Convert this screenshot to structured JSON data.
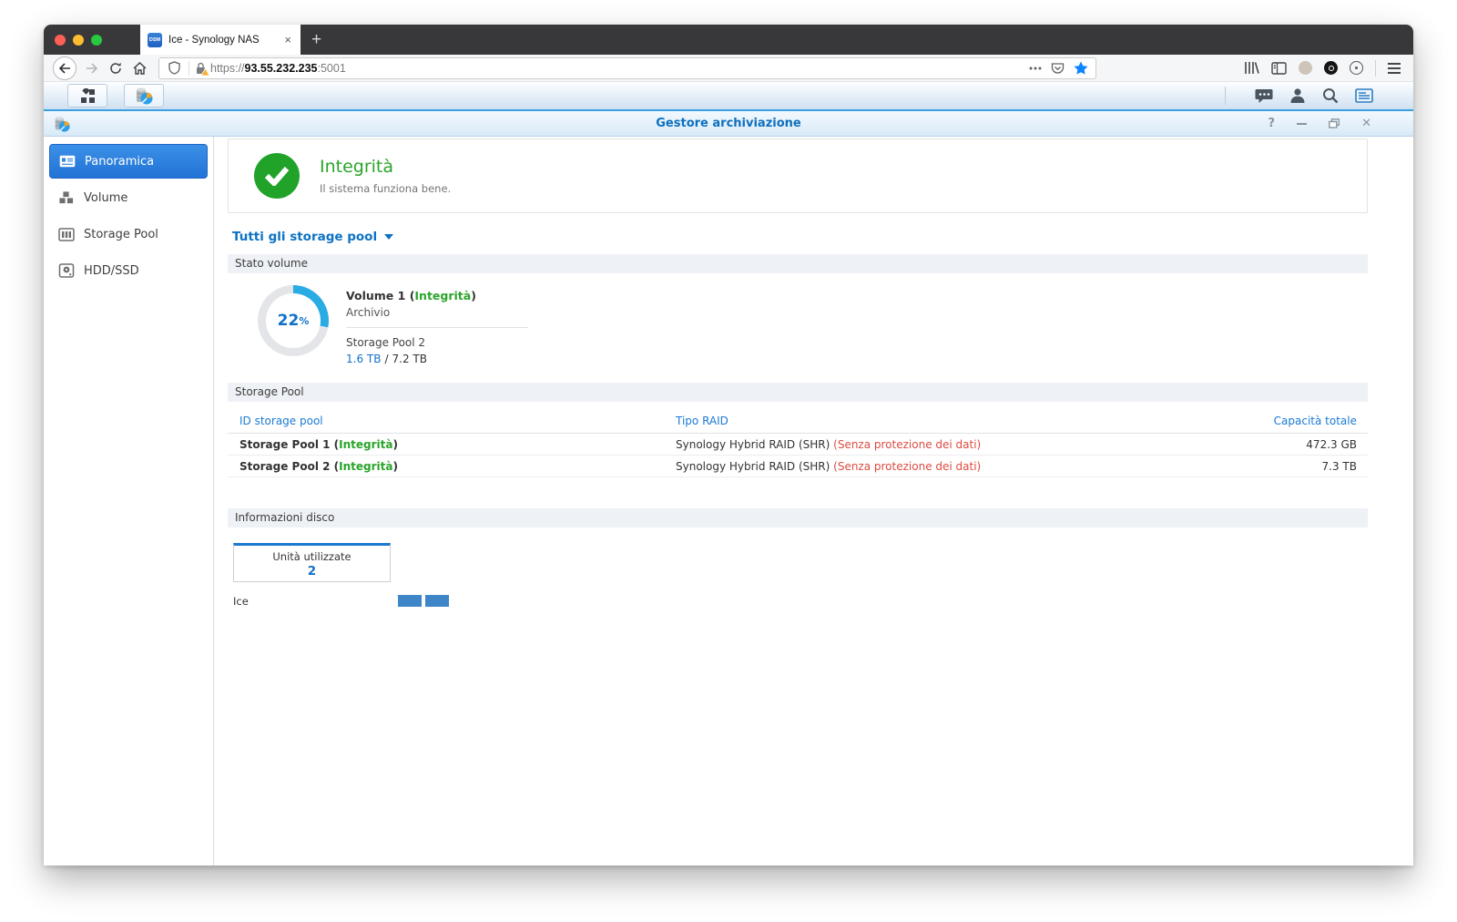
{
  "punct": {
    "open": "(",
    "close": ")",
    "slash": "/"
  },
  "browser": {
    "favicon_label": "DSM",
    "tab_title": "Ice - Synology NAS",
    "tab_close_glyph": "×",
    "new_tab_glyph": "+",
    "url_protocol": "https://",
    "url_host": "93.55.232.235",
    "url_port": ":5001"
  },
  "window": {
    "title": "Gestore archiviazione",
    "controls": {
      "help": "?",
      "close": "✕"
    },
    "sidebar": [
      {
        "label": "Panoramica"
      },
      {
        "label": "Volume"
      },
      {
        "label": "Storage Pool"
      },
      {
        "label": "HDD/SSD"
      }
    ],
    "health": {
      "title": "Integrità",
      "subtitle": "Il sistema funziona bene."
    },
    "pool_filter_label": "Tutti gli storage pool",
    "sections": {
      "volume_status": "Stato volume",
      "storage_pool": "Storage Pool",
      "disk_info": "Informazioni disco"
    },
    "volume": {
      "percent": "22",
      "percent_sign": "%",
      "name": "Volume 1",
      "status": "Integrità",
      "description": "Archivio",
      "pool_name": "Storage Pool 2",
      "used": "1.6 TB",
      "total": "7.2 TB"
    },
    "pool_table": {
      "headers": [
        "ID storage pool",
        "Tipo RAID",
        "Capacità totale"
      ],
      "rows": [
        {
          "name": "Storage Pool 1",
          "status": "Integrità",
          "raid": "Synology Hybrid RAID (SHR)",
          "warning": "(Senza protezione dei dati)",
          "capacity": "472.3 GB"
        },
        {
          "name": "Storage Pool 2",
          "status": "Integrità",
          "raid": "Synology Hybrid RAID (SHR)",
          "warning": "(Senza protezione dei dati)",
          "capacity": "7.3 TB"
        }
      ]
    },
    "disk_info": {
      "used_drives_label": "Unità utilizzate",
      "used_drives_value": "2",
      "host_name": "Ice"
    },
    "colors": {
      "accent_blue": "#1070c8",
      "healthy_green": "#2aa52a",
      "warning_red": "#dd4b42",
      "donut_blue": "#29ace3"
    }
  }
}
